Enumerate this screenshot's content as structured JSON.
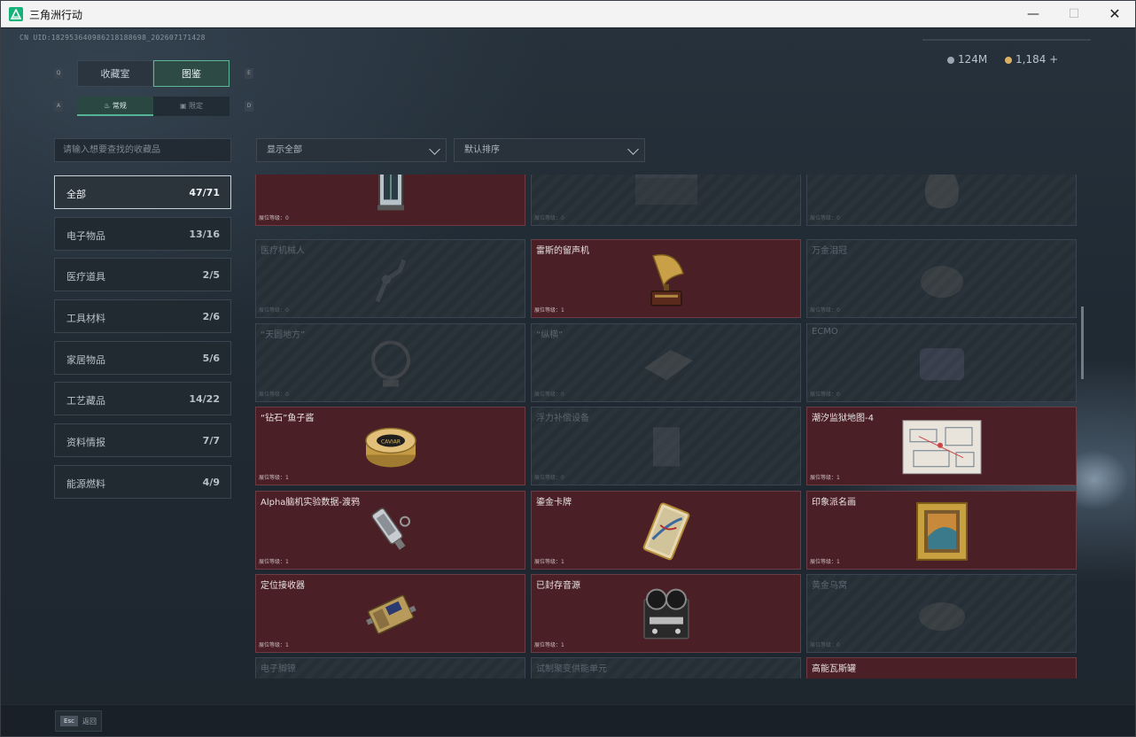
{
  "window": {
    "title": "三角洲行动",
    "minimize_glyph": "—",
    "maximize_glyph": "☐",
    "close_glyph": "✕"
  },
  "uid": "CN UID:182953640986218188698_202607171428",
  "currency": [
    {
      "icon": "silver-coin-icon",
      "value": "124M",
      "color": "#9aa7b2"
    },
    {
      "icon": "gold-coin-icon",
      "value": "1,184 +",
      "color": "#d9b064"
    }
  ],
  "tabs": {
    "main_left_key": "Q",
    "main_right_key": "E",
    "sub_left_key": "A",
    "sub_right_key": "D",
    "main": [
      {
        "label": "收藏室",
        "active": false
      },
      {
        "label": "图鉴",
        "active": true
      }
    ],
    "sub": [
      {
        "label": "常规",
        "icon": "flame-icon",
        "active": true
      },
      {
        "label": "限定",
        "icon": "frame-icon",
        "active": false
      }
    ]
  },
  "search": {
    "placeholder": "请输入想要查找的收藏品"
  },
  "categories": [
    {
      "label": "全部",
      "count": "47/71",
      "active": true
    },
    {
      "label": "电子物品",
      "count": "13/16"
    },
    {
      "label": "医疗道具",
      "count": "2/5"
    },
    {
      "label": "工具材料",
      "count": "2/6"
    },
    {
      "label": "家居物品",
      "count": "5/6"
    },
    {
      "label": "工艺藏品",
      "count": "14/22"
    },
    {
      "label": "资料情报",
      "count": "7/7"
    },
    {
      "label": "能源燃料",
      "count": "4/9"
    }
  ],
  "filters": {
    "show": "显示全部",
    "sort": "默认排序"
  },
  "level_label": "展位等级：",
  "items": [
    {
      "name": "",
      "level": "0",
      "owned": true,
      "icon": "lantern-icon"
    },
    {
      "name": "",
      "level": "0",
      "owned": false,
      "icon": "chest-icon"
    },
    {
      "name": "",
      "level": "0",
      "owned": false,
      "icon": "vase-icon"
    },
    {
      "name": "医疗机械人",
      "level": "0",
      "owned": false,
      "icon": "robot-arm-icon"
    },
    {
      "name": "雷斯的留声机",
      "level": "1",
      "owned": true,
      "icon": "gramophone-icon"
    },
    {
      "name": "万金泪冠",
      "level": "0",
      "owned": false,
      "icon": "crown-icon"
    },
    {
      "name": "“天圆地方”",
      "level": "0",
      "owned": false,
      "icon": "globe-icon"
    },
    {
      "name": "“纵横”",
      "level": "0",
      "owned": false,
      "icon": "board-icon"
    },
    {
      "name": "ECMO",
      "level": "0",
      "owned": false,
      "icon": "machine-icon"
    },
    {
      "name": "“钻石”鱼子酱",
      "level": "1",
      "owned": true,
      "icon": "caviar-tin-icon"
    },
    {
      "name": "浮力补偿设备",
      "level": "0",
      "owned": false,
      "icon": "diving-vest-icon"
    },
    {
      "name": "潮汐监狱地图-4",
      "level": "1",
      "owned": true,
      "icon": "map-icon"
    },
    {
      "name": "Alpha脑机实验数据-渡鸦",
      "level": "1",
      "owned": true,
      "icon": "usb-drive-icon"
    },
    {
      "name": "鎏金卡牌",
      "level": "1",
      "owned": true,
      "icon": "card-icon"
    },
    {
      "name": "印象派名画",
      "level": "1",
      "owned": true,
      "icon": "painting-icon"
    },
    {
      "name": "定位接收器",
      "level": "1",
      "owned": true,
      "icon": "receiver-icon"
    },
    {
      "name": "已封存音源",
      "level": "1",
      "owned": true,
      "icon": "reel-recorder-icon"
    },
    {
      "name": "黄金乌窝",
      "level": "0",
      "owned": false,
      "icon": "nest-icon"
    },
    {
      "name": "电子脚镣",
      "level": "",
      "owned": false,
      "icon": "anklet-icon"
    },
    {
      "name": "试制聚变供能单元",
      "level": "",
      "owned": false,
      "icon": "power-cell-icon"
    },
    {
      "name": "高能瓦斯罐",
      "level": "",
      "owned": true,
      "icon": "gas-tank-icon"
    }
  ],
  "footer": {
    "key": "Esc",
    "label": "返回"
  }
}
